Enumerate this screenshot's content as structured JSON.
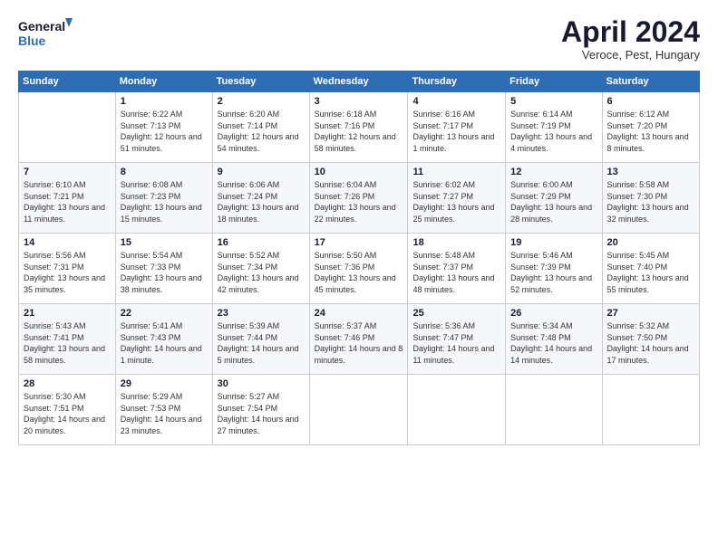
{
  "logo": {
    "line1": "General",
    "line2": "Blue"
  },
  "title": "April 2024",
  "subtitle": "Veroce, Pest, Hungary",
  "header": {
    "days": [
      "Sunday",
      "Monday",
      "Tuesday",
      "Wednesday",
      "Thursday",
      "Friday",
      "Saturday"
    ]
  },
  "weeks": [
    {
      "cells": [
        {
          "day": "",
          "sunrise": "",
          "sunset": "",
          "daylight": ""
        },
        {
          "day": "1",
          "sunrise": "Sunrise: 6:22 AM",
          "sunset": "Sunset: 7:13 PM",
          "daylight": "Daylight: 12 hours and 51 minutes."
        },
        {
          "day": "2",
          "sunrise": "Sunrise: 6:20 AM",
          "sunset": "Sunset: 7:14 PM",
          "daylight": "Daylight: 12 hours and 54 minutes."
        },
        {
          "day": "3",
          "sunrise": "Sunrise: 6:18 AM",
          "sunset": "Sunset: 7:16 PM",
          "daylight": "Daylight: 12 hours and 58 minutes."
        },
        {
          "day": "4",
          "sunrise": "Sunrise: 6:16 AM",
          "sunset": "Sunset: 7:17 PM",
          "daylight": "Daylight: 13 hours and 1 minute."
        },
        {
          "day": "5",
          "sunrise": "Sunrise: 6:14 AM",
          "sunset": "Sunset: 7:19 PM",
          "daylight": "Daylight: 13 hours and 4 minutes."
        },
        {
          "day": "6",
          "sunrise": "Sunrise: 6:12 AM",
          "sunset": "Sunset: 7:20 PM",
          "daylight": "Daylight: 13 hours and 8 minutes."
        }
      ]
    },
    {
      "cells": [
        {
          "day": "7",
          "sunrise": "Sunrise: 6:10 AM",
          "sunset": "Sunset: 7:21 PM",
          "daylight": "Daylight: 13 hours and 11 minutes."
        },
        {
          "day": "8",
          "sunrise": "Sunrise: 6:08 AM",
          "sunset": "Sunset: 7:23 PM",
          "daylight": "Daylight: 13 hours and 15 minutes."
        },
        {
          "day": "9",
          "sunrise": "Sunrise: 6:06 AM",
          "sunset": "Sunset: 7:24 PM",
          "daylight": "Daylight: 13 hours and 18 minutes."
        },
        {
          "day": "10",
          "sunrise": "Sunrise: 6:04 AM",
          "sunset": "Sunset: 7:26 PM",
          "daylight": "Daylight: 13 hours and 22 minutes."
        },
        {
          "day": "11",
          "sunrise": "Sunrise: 6:02 AM",
          "sunset": "Sunset: 7:27 PM",
          "daylight": "Daylight: 13 hours and 25 minutes."
        },
        {
          "day": "12",
          "sunrise": "Sunrise: 6:00 AM",
          "sunset": "Sunset: 7:29 PM",
          "daylight": "Daylight: 13 hours and 28 minutes."
        },
        {
          "day": "13",
          "sunrise": "Sunrise: 5:58 AM",
          "sunset": "Sunset: 7:30 PM",
          "daylight": "Daylight: 13 hours and 32 minutes."
        }
      ]
    },
    {
      "cells": [
        {
          "day": "14",
          "sunrise": "Sunrise: 5:56 AM",
          "sunset": "Sunset: 7:31 PM",
          "daylight": "Daylight: 13 hours and 35 minutes."
        },
        {
          "day": "15",
          "sunrise": "Sunrise: 5:54 AM",
          "sunset": "Sunset: 7:33 PM",
          "daylight": "Daylight: 13 hours and 38 minutes."
        },
        {
          "day": "16",
          "sunrise": "Sunrise: 5:52 AM",
          "sunset": "Sunset: 7:34 PM",
          "daylight": "Daylight: 13 hours and 42 minutes."
        },
        {
          "day": "17",
          "sunrise": "Sunrise: 5:50 AM",
          "sunset": "Sunset: 7:36 PM",
          "daylight": "Daylight: 13 hours and 45 minutes."
        },
        {
          "day": "18",
          "sunrise": "Sunrise: 5:48 AM",
          "sunset": "Sunset: 7:37 PM",
          "daylight": "Daylight: 13 hours and 48 minutes."
        },
        {
          "day": "19",
          "sunrise": "Sunrise: 5:46 AM",
          "sunset": "Sunset: 7:39 PM",
          "daylight": "Daylight: 13 hours and 52 minutes."
        },
        {
          "day": "20",
          "sunrise": "Sunrise: 5:45 AM",
          "sunset": "Sunset: 7:40 PM",
          "daylight": "Daylight: 13 hours and 55 minutes."
        }
      ]
    },
    {
      "cells": [
        {
          "day": "21",
          "sunrise": "Sunrise: 5:43 AM",
          "sunset": "Sunset: 7:41 PM",
          "daylight": "Daylight: 13 hours and 58 minutes."
        },
        {
          "day": "22",
          "sunrise": "Sunrise: 5:41 AM",
          "sunset": "Sunset: 7:43 PM",
          "daylight": "Daylight: 14 hours and 1 minute."
        },
        {
          "day": "23",
          "sunrise": "Sunrise: 5:39 AM",
          "sunset": "Sunset: 7:44 PM",
          "daylight": "Daylight: 14 hours and 5 minutes."
        },
        {
          "day": "24",
          "sunrise": "Sunrise: 5:37 AM",
          "sunset": "Sunset: 7:46 PM",
          "daylight": "Daylight: 14 hours and 8 minutes."
        },
        {
          "day": "25",
          "sunrise": "Sunrise: 5:36 AM",
          "sunset": "Sunset: 7:47 PM",
          "daylight": "Daylight: 14 hours and 11 minutes."
        },
        {
          "day": "26",
          "sunrise": "Sunrise: 5:34 AM",
          "sunset": "Sunset: 7:48 PM",
          "daylight": "Daylight: 14 hours and 14 minutes."
        },
        {
          "day": "27",
          "sunrise": "Sunrise: 5:32 AM",
          "sunset": "Sunset: 7:50 PM",
          "daylight": "Daylight: 14 hours and 17 minutes."
        }
      ]
    },
    {
      "cells": [
        {
          "day": "28",
          "sunrise": "Sunrise: 5:30 AM",
          "sunset": "Sunset: 7:51 PM",
          "daylight": "Daylight: 14 hours and 20 minutes."
        },
        {
          "day": "29",
          "sunrise": "Sunrise: 5:29 AM",
          "sunset": "Sunset: 7:53 PM",
          "daylight": "Daylight: 14 hours and 23 minutes."
        },
        {
          "day": "30",
          "sunrise": "Sunrise: 5:27 AM",
          "sunset": "Sunset: 7:54 PM",
          "daylight": "Daylight: 14 hours and 27 minutes."
        },
        {
          "day": "",
          "sunrise": "",
          "sunset": "",
          "daylight": ""
        },
        {
          "day": "",
          "sunrise": "",
          "sunset": "",
          "daylight": ""
        },
        {
          "day": "",
          "sunrise": "",
          "sunset": "",
          "daylight": ""
        },
        {
          "day": "",
          "sunrise": "",
          "sunset": "",
          "daylight": ""
        }
      ]
    }
  ]
}
